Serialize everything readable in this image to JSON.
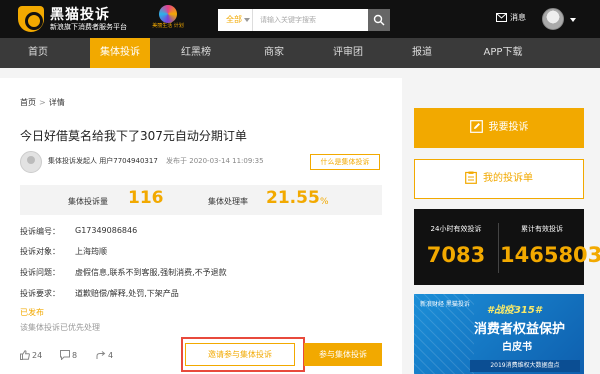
{
  "header": {
    "logo_name": "黑猫投诉",
    "logo_tagline": "新浪旗下消费者服务平台",
    "partner_label": "美丽生活 计划",
    "search": {
      "scope": "全部",
      "placeholder": "请输入关键字搜索"
    },
    "message_label": "消息"
  },
  "nav": {
    "items": [
      {
        "label": "首页"
      },
      {
        "label": "集体投诉"
      },
      {
        "label": "红黑榜"
      },
      {
        "label": "商家"
      },
      {
        "label": "评审团"
      },
      {
        "label": "报道"
      },
      {
        "label": "APP下载"
      }
    ],
    "active_index": 1
  },
  "breadcrumb": {
    "home": "首页",
    "sep": ">",
    "current": "详情"
  },
  "complaint": {
    "title": "今日好借莫名给我下了307元自动分期订单",
    "author_role": "集体投诉发起人",
    "author_name": "用户7704940317",
    "published": "发布于 2020-03-14 11:09:35",
    "what_label": "什么是集体投诉",
    "stats": {
      "count_label": "集体投诉量",
      "count_value": "116",
      "rate_label": "集体处理率",
      "rate_value": "21.55",
      "rate_unit": "%"
    },
    "fields": [
      {
        "label": "投诉编号：",
        "value": "G17349086846"
      },
      {
        "label": "投诉对象：",
        "value": "上海筠顺"
      },
      {
        "label": "投诉问题：",
        "value": "虚假信息,联系不到客服,强制消费,不予退款"
      },
      {
        "label": "投诉要求：",
        "value": "道歉赔偿/解释,处罚,下架产品"
      }
    ],
    "status": "已发布",
    "note": "该集体投诉已优先处理",
    "likes": "24",
    "comments": "8",
    "shares": "4",
    "invite_label": "邀请参与集体投诉",
    "join_label": "参与集体投诉"
  },
  "sidebar": {
    "complain_label": "我要投诉",
    "mine_label": "我的投诉单",
    "counter": {
      "left_label": "24小时有效投诉",
      "left_value": "7083",
      "right_label": "累计有效投诉",
      "right_value": "1465803"
    },
    "banner": {
      "brand": "新浪财经 黑猫投诉",
      "tag": "#战疫315#",
      "headline": "消费者权益保护",
      "subline": "白皮书",
      "footer": "2019消费维权大数据盘点"
    }
  },
  "colors": {
    "accent": "#f2a900",
    "header_bg": "#111111",
    "nav_bg": "#3a3a3a",
    "highlight_frame": "#e84a3c"
  }
}
